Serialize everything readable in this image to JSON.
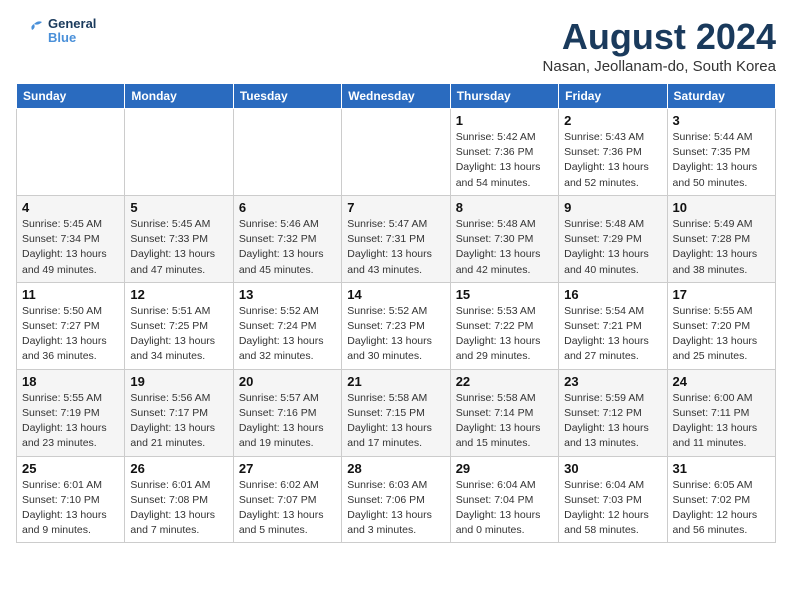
{
  "logo": {
    "line1": "General",
    "line2": "Blue"
  },
  "title": "August 2024",
  "subtitle": "Nasan, Jeollanam-do, South Korea",
  "weekdays": [
    "Sunday",
    "Monday",
    "Tuesday",
    "Wednesday",
    "Thursday",
    "Friday",
    "Saturday"
  ],
  "weeks": [
    [
      {
        "day": "",
        "info": ""
      },
      {
        "day": "",
        "info": ""
      },
      {
        "day": "",
        "info": ""
      },
      {
        "day": "",
        "info": ""
      },
      {
        "day": "1",
        "info": "Sunrise: 5:42 AM\nSunset: 7:36 PM\nDaylight: 13 hours\nand 54 minutes."
      },
      {
        "day": "2",
        "info": "Sunrise: 5:43 AM\nSunset: 7:36 PM\nDaylight: 13 hours\nand 52 minutes."
      },
      {
        "day": "3",
        "info": "Sunrise: 5:44 AM\nSunset: 7:35 PM\nDaylight: 13 hours\nand 50 minutes."
      }
    ],
    [
      {
        "day": "4",
        "info": "Sunrise: 5:45 AM\nSunset: 7:34 PM\nDaylight: 13 hours\nand 49 minutes."
      },
      {
        "day": "5",
        "info": "Sunrise: 5:45 AM\nSunset: 7:33 PM\nDaylight: 13 hours\nand 47 minutes."
      },
      {
        "day": "6",
        "info": "Sunrise: 5:46 AM\nSunset: 7:32 PM\nDaylight: 13 hours\nand 45 minutes."
      },
      {
        "day": "7",
        "info": "Sunrise: 5:47 AM\nSunset: 7:31 PM\nDaylight: 13 hours\nand 43 minutes."
      },
      {
        "day": "8",
        "info": "Sunrise: 5:48 AM\nSunset: 7:30 PM\nDaylight: 13 hours\nand 42 minutes."
      },
      {
        "day": "9",
        "info": "Sunrise: 5:48 AM\nSunset: 7:29 PM\nDaylight: 13 hours\nand 40 minutes."
      },
      {
        "day": "10",
        "info": "Sunrise: 5:49 AM\nSunset: 7:28 PM\nDaylight: 13 hours\nand 38 minutes."
      }
    ],
    [
      {
        "day": "11",
        "info": "Sunrise: 5:50 AM\nSunset: 7:27 PM\nDaylight: 13 hours\nand 36 minutes."
      },
      {
        "day": "12",
        "info": "Sunrise: 5:51 AM\nSunset: 7:25 PM\nDaylight: 13 hours\nand 34 minutes."
      },
      {
        "day": "13",
        "info": "Sunrise: 5:52 AM\nSunset: 7:24 PM\nDaylight: 13 hours\nand 32 minutes."
      },
      {
        "day": "14",
        "info": "Sunrise: 5:52 AM\nSunset: 7:23 PM\nDaylight: 13 hours\nand 30 minutes."
      },
      {
        "day": "15",
        "info": "Sunrise: 5:53 AM\nSunset: 7:22 PM\nDaylight: 13 hours\nand 29 minutes."
      },
      {
        "day": "16",
        "info": "Sunrise: 5:54 AM\nSunset: 7:21 PM\nDaylight: 13 hours\nand 27 minutes."
      },
      {
        "day": "17",
        "info": "Sunrise: 5:55 AM\nSunset: 7:20 PM\nDaylight: 13 hours\nand 25 minutes."
      }
    ],
    [
      {
        "day": "18",
        "info": "Sunrise: 5:55 AM\nSunset: 7:19 PM\nDaylight: 13 hours\nand 23 minutes."
      },
      {
        "day": "19",
        "info": "Sunrise: 5:56 AM\nSunset: 7:17 PM\nDaylight: 13 hours\nand 21 minutes."
      },
      {
        "day": "20",
        "info": "Sunrise: 5:57 AM\nSunset: 7:16 PM\nDaylight: 13 hours\nand 19 minutes."
      },
      {
        "day": "21",
        "info": "Sunrise: 5:58 AM\nSunset: 7:15 PM\nDaylight: 13 hours\nand 17 minutes."
      },
      {
        "day": "22",
        "info": "Sunrise: 5:58 AM\nSunset: 7:14 PM\nDaylight: 13 hours\nand 15 minutes."
      },
      {
        "day": "23",
        "info": "Sunrise: 5:59 AM\nSunset: 7:12 PM\nDaylight: 13 hours\nand 13 minutes."
      },
      {
        "day": "24",
        "info": "Sunrise: 6:00 AM\nSunset: 7:11 PM\nDaylight: 13 hours\nand 11 minutes."
      }
    ],
    [
      {
        "day": "25",
        "info": "Sunrise: 6:01 AM\nSunset: 7:10 PM\nDaylight: 13 hours\nand 9 minutes."
      },
      {
        "day": "26",
        "info": "Sunrise: 6:01 AM\nSunset: 7:08 PM\nDaylight: 13 hours\nand 7 minutes."
      },
      {
        "day": "27",
        "info": "Sunrise: 6:02 AM\nSunset: 7:07 PM\nDaylight: 13 hours\nand 5 minutes."
      },
      {
        "day": "28",
        "info": "Sunrise: 6:03 AM\nSunset: 7:06 PM\nDaylight: 13 hours\nand 3 minutes."
      },
      {
        "day": "29",
        "info": "Sunrise: 6:04 AM\nSunset: 7:04 PM\nDaylight: 13 hours\nand 0 minutes."
      },
      {
        "day": "30",
        "info": "Sunrise: 6:04 AM\nSunset: 7:03 PM\nDaylight: 12 hours\nand 58 minutes."
      },
      {
        "day": "31",
        "info": "Sunrise: 6:05 AM\nSunset: 7:02 PM\nDaylight: 12 hours\nand 56 minutes."
      }
    ]
  ]
}
